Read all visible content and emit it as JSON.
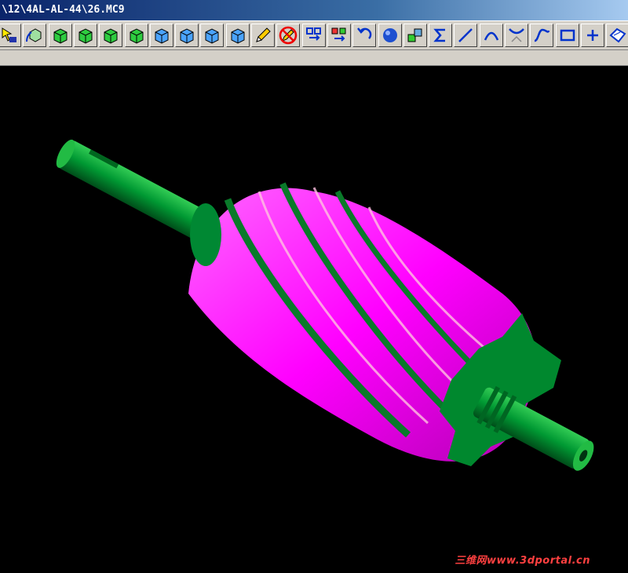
{
  "window": {
    "title": "\\12\\4AL-AL-44\\26.MC9"
  },
  "toolbar": {
    "buttons": [
      {
        "icon": "select-entity-icon"
      },
      {
        "icon": "view-cube-rotate-icon"
      },
      {
        "icon": "cube-green-1-icon"
      },
      {
        "icon": "cube-green-2-icon"
      },
      {
        "icon": "cube-green-3-icon"
      },
      {
        "icon": "cube-green-4-icon"
      },
      {
        "icon": "cube-blue-1-icon"
      },
      {
        "icon": "cube-blue-2-icon"
      },
      {
        "icon": "cube-blue-3-icon"
      },
      {
        "icon": "cube-blue-4-icon"
      },
      {
        "icon": "pencil-icon"
      },
      {
        "icon": "no-pencil-icon"
      },
      {
        "icon": "translate-icon"
      },
      {
        "icon": "copy-translate-icon"
      },
      {
        "icon": "undo-icon"
      },
      {
        "icon": "sphere-icon"
      },
      {
        "icon": "layers-icon"
      },
      {
        "icon": "sigma-icon"
      },
      {
        "icon": "line-icon"
      },
      {
        "icon": "arc-icon"
      },
      {
        "icon": "fillet-icon"
      },
      {
        "icon": "spline-icon"
      },
      {
        "icon": "rectangle-icon"
      },
      {
        "icon": "point-plus-icon"
      },
      {
        "icon": "surface-icon"
      },
      {
        "icon": "more-icon"
      }
    ]
  },
  "colors": {
    "rotor": "#ff00ff",
    "shaft": "#009933",
    "background": "#000000",
    "watermark": "#ff4040"
  },
  "watermark": {
    "text": "三维网www.3dportal.cn"
  }
}
